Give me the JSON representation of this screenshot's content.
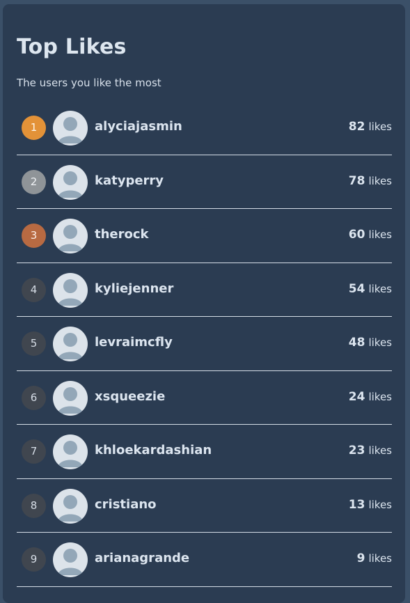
{
  "panel": {
    "title": "Top Likes",
    "subtitle": "The users you like the most"
  },
  "users": [
    {
      "rank": "1",
      "username": "alyciajasmin",
      "likes": "82",
      "unit": "likes",
      "medal": "gold"
    },
    {
      "rank": "2",
      "username": "katyperry",
      "likes": "78",
      "unit": "likes",
      "medal": "silver"
    },
    {
      "rank": "3",
      "username": "therock",
      "likes": "60",
      "unit": "likes",
      "medal": "bronze"
    },
    {
      "rank": "4",
      "username": "kyliejenner",
      "likes": "54",
      "unit": "likes",
      "medal": "none"
    },
    {
      "rank": "5",
      "username": "levraimcfly",
      "likes": "48",
      "unit": "likes",
      "medal": "none"
    },
    {
      "rank": "6",
      "username": "xsqueezie",
      "likes": "24",
      "unit": "likes",
      "medal": "none"
    },
    {
      "rank": "7",
      "username": "khloekardashian",
      "likes": "23",
      "unit": "likes",
      "medal": "none"
    },
    {
      "rank": "8",
      "username": "cristiano",
      "likes": "13",
      "unit": "likes",
      "medal": "none"
    },
    {
      "rank": "9",
      "username": "arianagrande",
      "likes": "9",
      "unit": "likes",
      "medal": "none"
    }
  ],
  "icons": {
    "avatar": "user-avatar-icon"
  },
  "colors": {
    "background": "#3b5068",
    "card": "#2b3c52",
    "gold": "#e39238",
    "silver": "#8f9498",
    "bronze": "#b86a42",
    "rank_default": "#40464f"
  }
}
